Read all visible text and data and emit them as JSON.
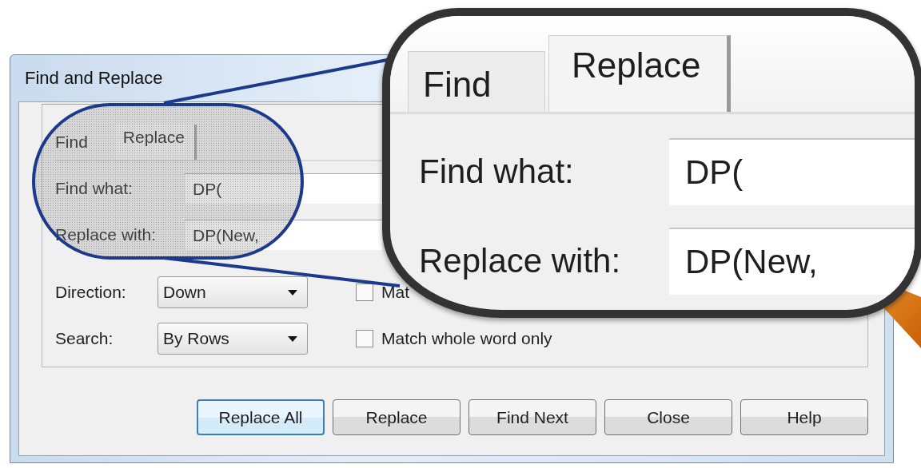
{
  "window": {
    "title": "Find and Replace"
  },
  "tabs": [
    {
      "label": "Find",
      "selected": false
    },
    {
      "label": "Replace",
      "selected": true
    }
  ],
  "fields": [
    {
      "label": "Find what:",
      "value": "DP("
    },
    {
      "label": "Replace with:",
      "value": "DP(New,"
    }
  ],
  "dropdowns": [
    {
      "label": "Direction:",
      "value": "Down"
    },
    {
      "label": "Search:",
      "value": "By Rows"
    }
  ],
  "checkboxes": [
    {
      "label": "Mat",
      "checked": false
    },
    {
      "label": "Match whole word only",
      "checked": false
    }
  ],
  "buttons": [
    {
      "label": "Replace All",
      "default": true
    },
    {
      "label": "Replace",
      "default": false
    },
    {
      "label": "Find Next",
      "default": false
    },
    {
      "label": "Close",
      "default": false
    },
    {
      "label": "Help",
      "default": false
    }
  ],
  "magnifier": {
    "tabs": [
      {
        "label": "Find",
        "selected": false
      },
      {
        "label": "Replace",
        "selected": true
      }
    ],
    "fields": [
      {
        "label": "Find what:",
        "value": "DP("
      },
      {
        "label": "Replace with:",
        "value": "DP(New,"
      }
    ]
  }
}
